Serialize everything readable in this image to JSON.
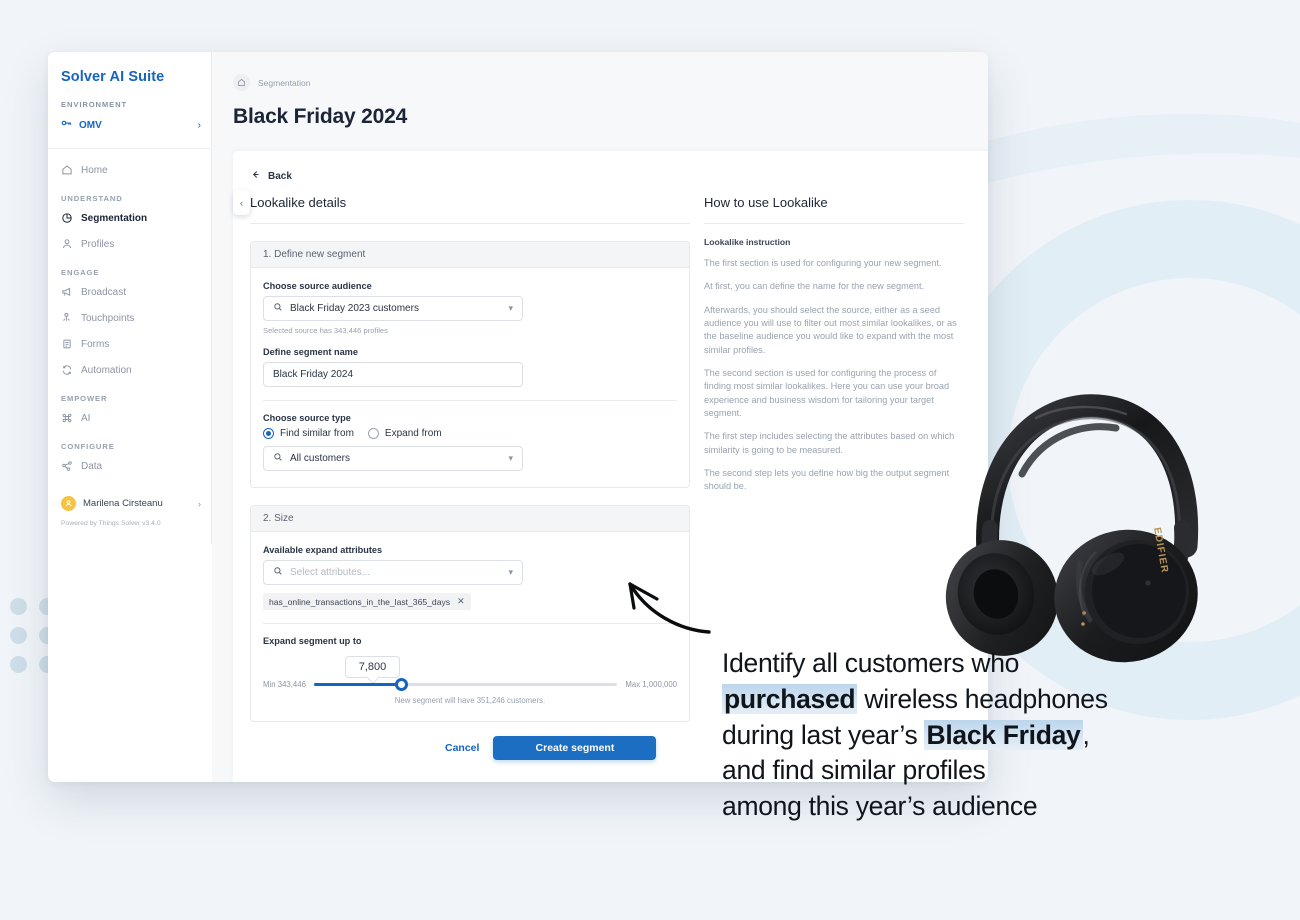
{
  "sidebar": {
    "brand": "Solver AI Suite",
    "environment_caption": "ENVIRONMENT",
    "environment_value": "OMV",
    "environment_chevron": "chevron-right",
    "collapse_icon": "chevron-left",
    "home": {
      "label": "Home",
      "icon": "home-icon"
    },
    "sections": [
      {
        "caption": "UNDERSTAND",
        "items": [
          {
            "label": "Segmentation",
            "icon": "pie-chart-icon",
            "active": true
          },
          {
            "label": "Profiles",
            "icon": "person-icon",
            "active": false
          }
        ]
      },
      {
        "caption": "ENGAGE",
        "items": [
          {
            "label": "Broadcast",
            "icon": "megaphone-icon",
            "active": false
          },
          {
            "label": "Touchpoints",
            "icon": "touch-icon",
            "active": false
          },
          {
            "label": "Forms",
            "icon": "form-icon",
            "active": false
          },
          {
            "label": "Automation",
            "icon": "refresh-icon",
            "active": false
          }
        ]
      },
      {
        "caption": "EMPOWER",
        "items": [
          {
            "label": "AI",
            "icon": "command-icon",
            "active": false
          }
        ]
      },
      {
        "caption": "CONFIGURE",
        "items": [
          {
            "label": "Data",
            "icon": "share-nodes-icon",
            "active": false
          }
        ]
      }
    ],
    "user": {
      "name": "Marilena Cirsteanu",
      "chevron": "chevron-right",
      "avatar_color": "#f5c242"
    },
    "powered_by": "Powered by Things Solver v3.4.0"
  },
  "header": {
    "breadcrumb_home_icon": "home-icon",
    "breadcrumb": "Segmentation",
    "page_title": "Black Friday 2024"
  },
  "form": {
    "back_label": "Back",
    "back_icon": "arrow-left-icon",
    "section_title": "Lookalike details",
    "step1": {
      "header": "1. Define new segment",
      "source_audience_label": "Choose source audience",
      "source_audience_value": "Black Friday 2023 customers",
      "source_audience_hint": "Selected source has 343,446 profiles",
      "segment_name_label": "Define segment name",
      "segment_name_value": "Black Friday 2024",
      "source_type_label": "Choose source type",
      "radio_find_similar": "Find similar from",
      "radio_expand_from": "Expand from",
      "selected_radio": "find_similar",
      "source_type_value": "All customers"
    },
    "step2": {
      "header": "2. Size",
      "attributes_label": "Available expand attributes",
      "attributes_placeholder": "Select attributes...",
      "chips": [
        "has_online_transactions_in_the_last_365_days"
      ],
      "chip_remove_icon": "close-icon",
      "expand_label": "Expand segment up to",
      "slider_value": "7,800",
      "slider_min_label": "Min 343,446",
      "slider_max_label": "Max 1,000,000",
      "slider_note": "New segment will have 351,246 customers."
    },
    "cancel_label": "Cancel",
    "create_label": "Create segment",
    "primary_color": "#1b6ec2",
    "link_color": "#1564c0"
  },
  "help": {
    "title": "How to use Lookalike",
    "subtitle": "Lookalike instruction",
    "paragraphs": [
      "The first section is used for configuring your new segment.",
      "At first, you can define the name for the new segment.",
      "Afterwards, you should select the source, either as a seed audience you will use to filter out most similar lookalikes, or as the baseline audience you would like to expand with the most similar profiles.",
      "The second section is used for configuring the process of finding most similar lookalikes. Here you can use your broad experience and business wisdom for tailoring your target segment.",
      "The first step includes selecting the attributes based on which similarity is going to be measured.",
      "The second step lets you define how big the output segment should be."
    ]
  },
  "promo": {
    "product_image": "black-wireless-over-ear-headphones",
    "arrow": "curved-arrow-pointing-up-left",
    "caption_line1_a": "Identify all customers who",
    "caption_line2_hl": "purchased",
    "caption_line2_b": " wireless headphones",
    "caption_line3_a": "during last year’s ",
    "caption_line3_hl": "Black Friday",
    "caption_line3_b": ",",
    "caption_line4": "and find similar profiles",
    "caption_line5": "among this year’s audience",
    "highlight_color": "#bcd5ec"
  },
  "decor": {
    "background_color": "#f1f5f9",
    "dot_color": "#cfdfe9",
    "ring_color": "#dfecf5",
    "dot_rows": 3,
    "dot_cols": 5
  }
}
